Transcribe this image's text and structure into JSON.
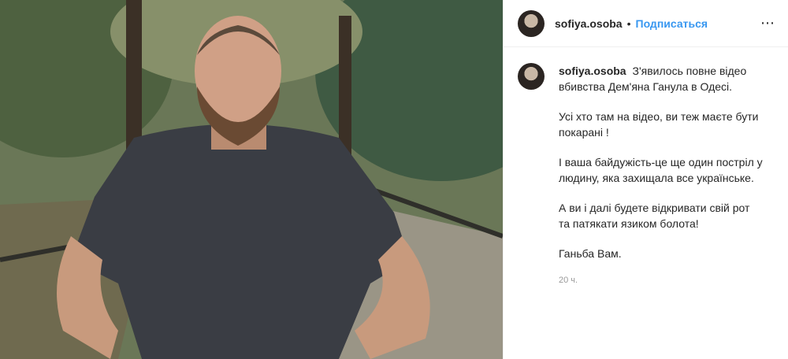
{
  "post": {
    "username": "sofiya.osoba",
    "separator": "•",
    "follow_label": "Подписаться",
    "more_icon": "⋯",
    "caption": [
      "З'явилось повне відео вбивства Дем'яна Ганула в Одесі.",
      "Усі хто там на відео, ви теж маєте бути покарані !",
      "І ваша байдужість-це ще один постріл у людину, яка захищала все українське.",
      "А ви і далі будете відкривати свій рот та патякати язиком болота!",
      "Ганьба Вам."
    ],
    "time_ago": "20 ч."
  }
}
